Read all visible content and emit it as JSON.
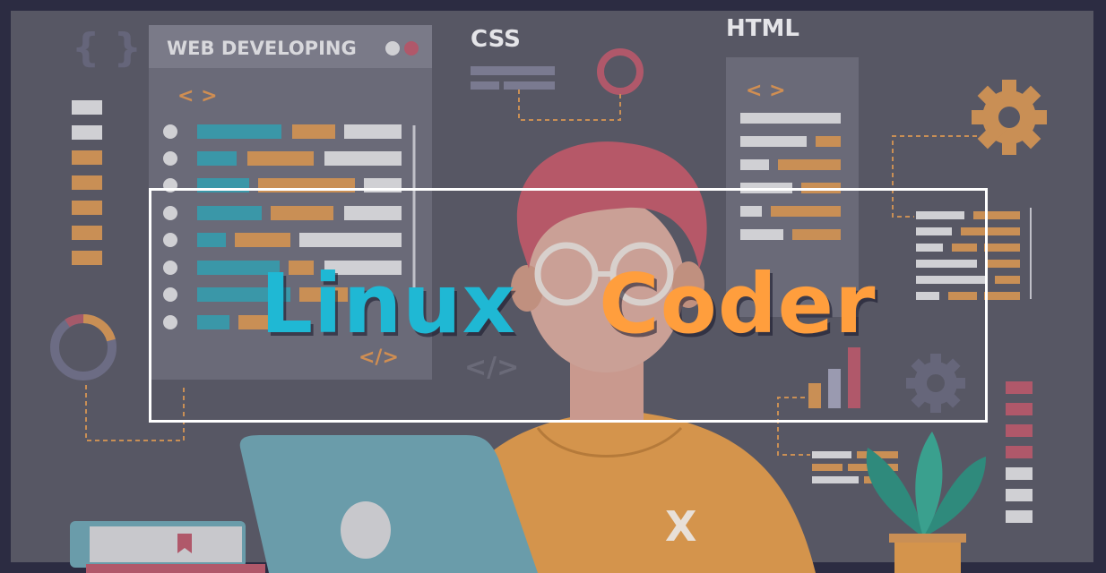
{
  "banner": {
    "panel_title": "WEB DEVELOPING",
    "css_label": "CSS",
    "html_label": "HTML",
    "open_tag": "< >",
    "close_tag": "</>",
    "braces": "{ }",
    "shirt_mark": "X"
  },
  "site_title": {
    "word1": "Linux",
    "word2": "Coder"
  },
  "colors": {
    "background": "#5a5a66",
    "teal": "#1fb8d4",
    "orange": "#ff9e3d",
    "frame": "#ffffff"
  }
}
